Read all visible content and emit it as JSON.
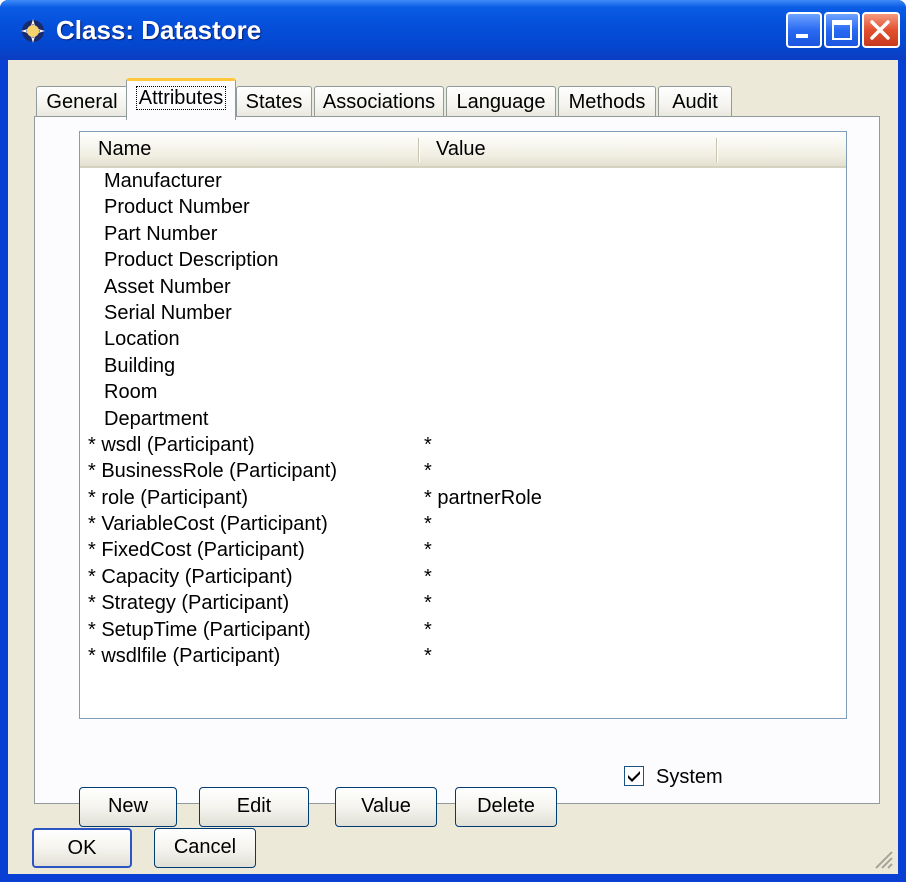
{
  "window": {
    "title": "Class: Datastore",
    "icons": {
      "app": "class-app-icon",
      "minimize": "minimize-icon",
      "maximize": "maximize-icon",
      "close": "close-icon"
    }
  },
  "tabs": [
    {
      "label": "General"
    },
    {
      "label": "Attributes",
      "active": true
    },
    {
      "label": "States"
    },
    {
      "label": "Associations"
    },
    {
      "label": "Language"
    },
    {
      "label": "Methods"
    },
    {
      "label": "Audit"
    }
  ],
  "list": {
    "columns": {
      "name": "Name",
      "value": "Value"
    },
    "rows": [
      {
        "name": "Manufacturer",
        "value": ""
      },
      {
        "name": "Product Number",
        "value": ""
      },
      {
        "name": "Part Number",
        "value": ""
      },
      {
        "name": "Product Description",
        "value": ""
      },
      {
        "name": "Asset Number",
        "value": ""
      },
      {
        "name": "Serial Number",
        "value": ""
      },
      {
        "name": "Location",
        "value": ""
      },
      {
        "name": "Building",
        "value": ""
      },
      {
        "name": "Room",
        "value": ""
      },
      {
        "name": "Department",
        "value": ""
      },
      {
        "name": "* wsdl (Participant)",
        "value": "*"
      },
      {
        "name": "* BusinessRole (Participant)",
        "value": "*"
      },
      {
        "name": "* role (Participant)",
        "value": "* partnerRole"
      },
      {
        "name": "* VariableCost (Participant)",
        "value": "*"
      },
      {
        "name": "* FixedCost (Participant)",
        "value": "*"
      },
      {
        "name": "* Capacity (Participant)",
        "value": "*"
      },
      {
        "name": "* Strategy (Participant)",
        "value": "*"
      },
      {
        "name": "* SetupTime (Participant)",
        "value": "*"
      },
      {
        "name": "* wsdlfile (Participant)",
        "value": "*"
      }
    ]
  },
  "buttons": {
    "new": "New",
    "edit": "Edit",
    "value": "Value",
    "delete": "Delete",
    "ok": "OK",
    "cancel": "Cancel"
  },
  "system_checkbox": {
    "label": "System",
    "checked": true
  },
  "colors": {
    "titlebar": "#0550db",
    "dialog_bg": "#ece9d8",
    "active_tab_accent": "#ffc83c"
  }
}
